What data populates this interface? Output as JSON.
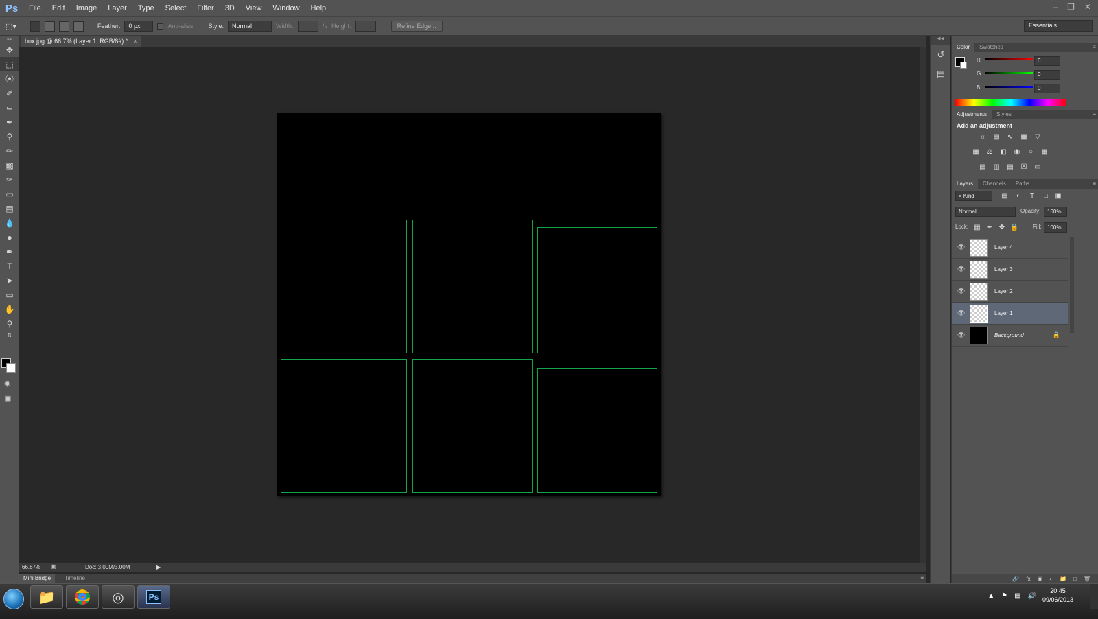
{
  "app": {
    "logo": "Ps"
  },
  "menu": [
    "File",
    "Edit",
    "Image",
    "Layer",
    "Type",
    "Select",
    "Filter",
    "3D",
    "View",
    "Window",
    "Help"
  ],
  "options_bar": {
    "feather_label": "Feather:",
    "feather_value": "0 px",
    "antialias_label": "Anti-alias",
    "style_label": "Style:",
    "style_value": "Normal",
    "width_label": "Width:",
    "height_label": "Height:",
    "refine_label": "Refine Edge...",
    "workspace": "Essentials"
  },
  "document": {
    "tab_title": "box.jpg @ 66.7% (Layer 1, RGB/8#) *",
    "boxes_color": "#15a34a",
    "zoom": "66.67%",
    "doc_size": "Doc: 3.00M/3.00M"
  },
  "bottom_tabs": [
    "Mini Bridge",
    "Timeline"
  ],
  "color_panel": {
    "tabs": [
      "Color",
      "Swatches"
    ],
    "r_label": "R",
    "r_value": "0",
    "g_label": "G",
    "g_value": "0",
    "b_label": "B",
    "b_value": "0"
  },
  "adjustments_panel": {
    "tabs": [
      "Adjustments",
      "Styles"
    ],
    "heading": "Add an adjustment"
  },
  "layers_panel": {
    "tabs": [
      "Layers",
      "Channels",
      "Paths"
    ],
    "filter_kind": "Kind",
    "blend_mode": "Normal",
    "opacity_label": "Opacity:",
    "opacity_value": "100%",
    "lock_label": "Lock:",
    "fill_label": "Fill:",
    "fill_value": "100%",
    "layers": [
      "Layer 4",
      "Layer 3",
      "Layer 2",
      "Layer 1",
      "Background"
    ],
    "selected_layer": "Layer 1"
  },
  "taskbar": {
    "time": "20:45",
    "date": "09/06/2013"
  }
}
